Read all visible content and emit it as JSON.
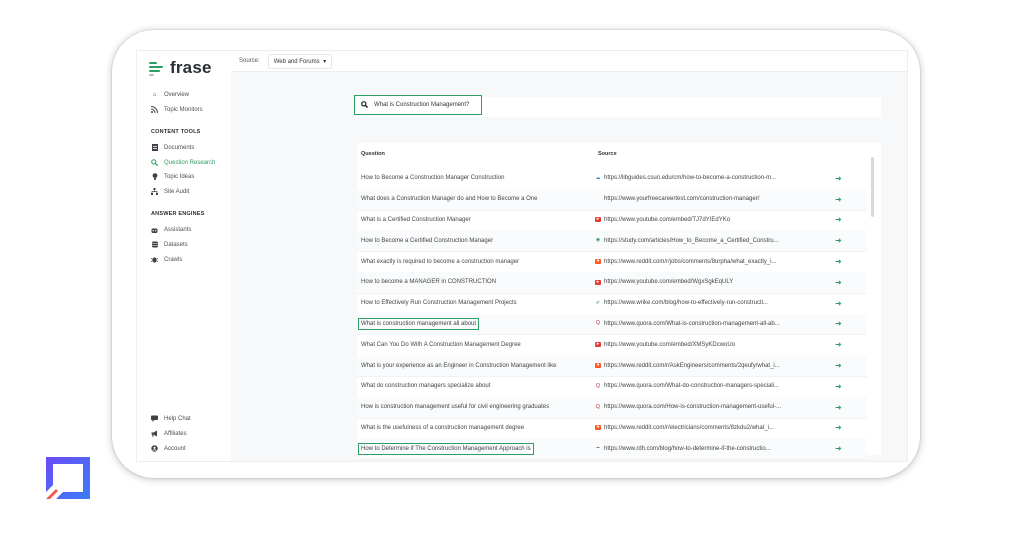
{
  "brand": {
    "name": "frase",
    "accent": "#2d9e64"
  },
  "sidebar": {
    "top_items": [
      {
        "label": "Overview",
        "icon": "home-icon"
      },
      {
        "label": "Topic Monitors",
        "icon": "rss-icon"
      }
    ],
    "content_tools_label": "CONTENT TOOLS",
    "content_tools": [
      {
        "label": "Documents",
        "icon": "document-icon",
        "active": false
      },
      {
        "label": "Question Research",
        "icon": "search-icon",
        "active": true
      },
      {
        "label": "Topic Ideas",
        "icon": "lightbulb-icon",
        "active": false
      },
      {
        "label": "Site Audit",
        "icon": "sitemap-icon",
        "active": false
      }
    ],
    "answer_engines_label": "ANSWER ENGINES",
    "answer_engines": [
      {
        "label": "Assistants",
        "icon": "robot-icon"
      },
      {
        "label": "Datasets",
        "icon": "database-icon"
      },
      {
        "label": "Crawls",
        "icon": "bug-icon"
      }
    ],
    "bottom_items": [
      {
        "label": "Help Chat",
        "icon": "chat-icon"
      },
      {
        "label": "Affiliates",
        "icon": "megaphone-icon"
      },
      {
        "label": "Account",
        "icon": "user-circle-icon"
      }
    ]
  },
  "topbar": {
    "source_label": "Source:",
    "source_value": "Web and Forums",
    "chevron": "▾"
  },
  "search": {
    "value": "What is Construction Management?"
  },
  "table": {
    "headers": {
      "question": "Question",
      "source": "Source"
    },
    "rows": [
      {
        "question": "How to Become a Construction Manager Construction",
        "source": "https://libguides.csun.edu/cm/how-to-become-a-construction-m...",
        "favicon": "cloud",
        "highlight": false
      },
      {
        "question": "What does a Construction Manager do and How to Become a One",
        "source": "https://www.yourfreecareertest.com/construction-manager/",
        "favicon": "none",
        "highlight": false
      },
      {
        "question": "What is a Certified Construction Manager",
        "source": "https://www.youtube.com/embed/TJ7dYIEdYKo",
        "favicon": "youtube",
        "highlight": false
      },
      {
        "question": "How to Become a Certified Construction Manager",
        "source": "https://study.com/articles/How_to_Become_a_Certified_Constru...",
        "favicon": "study",
        "highlight": false
      },
      {
        "question": "What exactly is required to become a construction manager",
        "source": "https://www.reddit.com/r/jobs/comments/8urpha/what_exactly_i...",
        "favicon": "reddit",
        "highlight": false
      },
      {
        "question": "How to become a MANAGER in CONSTRUCTION",
        "source": "https://www.youtube.com/embed/WgxSgkEqULY",
        "favicon": "youtube",
        "highlight": false
      },
      {
        "question": "How to Effectively Run Construction Management Projects",
        "source": "https://www.wrike.com/blog/how-to-effectively-run-constructi...",
        "favicon": "wrike",
        "highlight": false
      },
      {
        "question": "What is construction management all about",
        "source": "https://www.quora.com/What-is-construction-management-all-ab...",
        "favicon": "quora",
        "highlight": true
      },
      {
        "question": "What Can You Do With A Construction Management Degree",
        "source": "https://www.youtube.com/embed/XMSyKDcwoUo",
        "favicon": "youtube",
        "highlight": false
      },
      {
        "question": "What is your experience as an Engineer in Construction Management like",
        "source": "https://www.reddit.com/r/AskEngineers/comments/2qeufy/what_i...",
        "favicon": "reddit",
        "highlight": false
      },
      {
        "question": "What do construction managers specialize about",
        "source": "https://www.quora.com/What-do-construction-managers-speciali...",
        "favicon": "quora",
        "highlight": false
      },
      {
        "question": "How is construction management useful for civil engineering graduates",
        "source": "https://www.quora.com/How-is-construction-management-useful-...",
        "favicon": "quora",
        "highlight": false
      },
      {
        "question": "What is the usefulness of a construction management degree",
        "source": "https://www.reddit.com/r/electricians/comments/8zkdu2/what_i...",
        "favicon": "reddit",
        "highlight": false
      },
      {
        "question": "How to Determine if The Construction Management Approach is",
        "source": "https://www.rdh.com/blog/how-to-determine-if-the-constructio...",
        "favicon": "rdh",
        "highlight": true
      }
    ]
  }
}
